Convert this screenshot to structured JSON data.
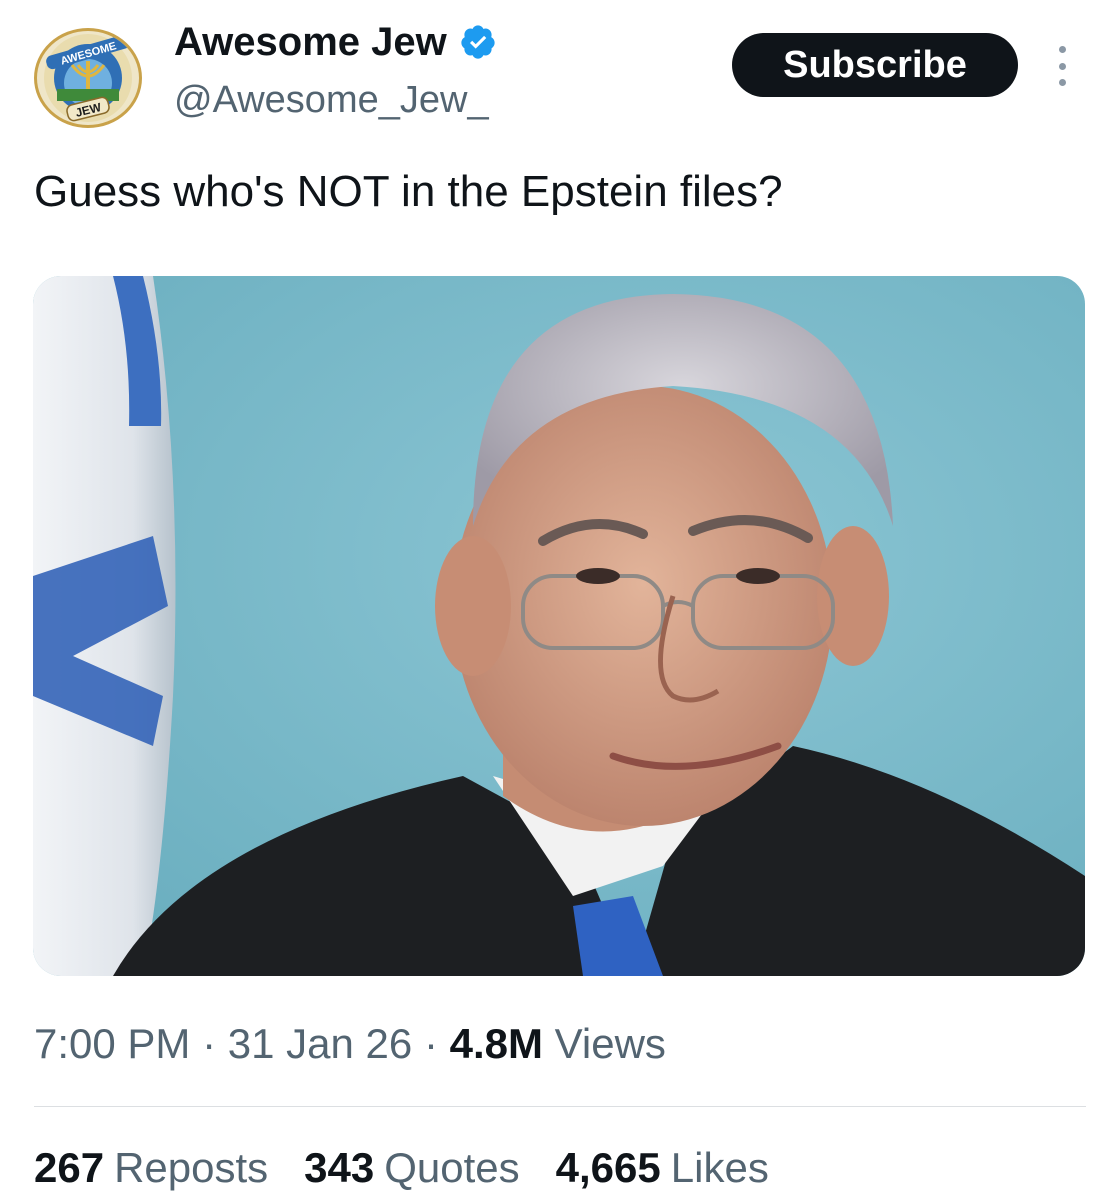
{
  "author": {
    "display_name": "Awesome Jew",
    "handle": "@Awesome_Jew_",
    "verified": true,
    "avatar_icon": "awesome-jew-logo-icon",
    "avatar_text_top": "AWESOME",
    "avatar_text_bottom": "JEW"
  },
  "header": {
    "subscribe_label": "Subscribe",
    "more_icon": "more-vertical-icon"
  },
  "tweet": {
    "text": "Guess who's NOT in the Epstein files?",
    "time": "7:00 PM",
    "date": "31 Jan 26",
    "views_count": "4.8M",
    "views_label": "Views",
    "separator": "·"
  },
  "stats": {
    "reposts_count": "267",
    "reposts_label": "Reposts",
    "quotes_count": "343",
    "quotes_label": "Quotes",
    "likes_count": "4,665",
    "likes_label": "Likes"
  },
  "colors": {
    "accent": "#1d9bf0",
    "text_primary": "#0f1419",
    "text_secondary": "#536471",
    "button_bg": "#0f1419"
  }
}
